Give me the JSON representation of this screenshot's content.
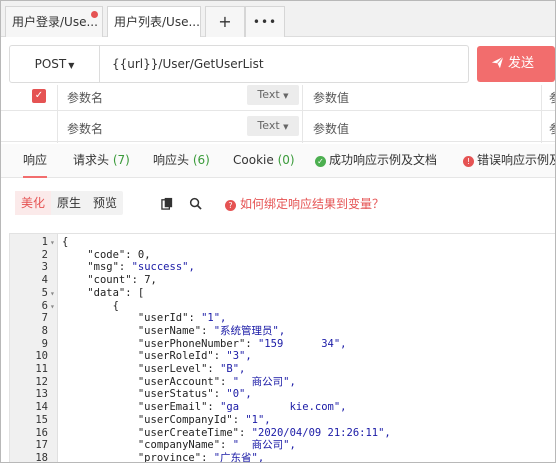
{
  "tabs": [
    {
      "label": "用户登录/Use..."
    },
    {
      "label": "用户列表/Use..."
    }
  ],
  "tab_actions": {
    "plus": "+",
    "more": "•••"
  },
  "request": {
    "method": "POST",
    "url": "{{url}}/User/GetUserList",
    "send_label": "发送"
  },
  "params": {
    "rows": [
      {
        "name": "参数名",
        "type": "Text",
        "value": "参数值",
        "cut": "参"
      },
      {
        "name": "参数名",
        "type": "Text",
        "value": "参数值",
        "cut": "参"
      }
    ]
  },
  "response_tabs": {
    "response": "响应",
    "req_headers": "请求头",
    "req_headers_count": "(7)",
    "res_headers": "响应头",
    "res_headers_count": "(6)",
    "cookie": "Cookie",
    "cookie_count": "(0)",
    "success_example": "成功响应示例及文档",
    "error_example": "错误响应示例及"
  },
  "toolbar": {
    "pretty": "美化",
    "raw": "原生",
    "preview": "预览",
    "help": "如何绑定响应结果到变量？"
  },
  "code_lines": [
    {
      "n": "1",
      "fold": "▾",
      "text": "{"
    },
    {
      "n": "2",
      "text": "    \"code\": 0,"
    },
    {
      "n": "3",
      "text": "    \"msg\": \"success\","
    },
    {
      "n": "4",
      "text": "    \"count\": 7,"
    },
    {
      "n": "5",
      "fold": "▾",
      "text": "    \"data\": ["
    },
    {
      "n": "6",
      "fold": "▾",
      "text": "        {"
    },
    {
      "n": "7",
      "text": "            \"userId\": \"1\","
    },
    {
      "n": "8",
      "text": "            \"userName\": \"系统管理员\","
    },
    {
      "n": "9",
      "text": "            \"userPhoneNumber\": \"159      34\","
    },
    {
      "n": "10",
      "text": "            \"userRoleId\": \"3\","
    },
    {
      "n": "11",
      "text": "            \"userLevel\": \"B\","
    },
    {
      "n": "12",
      "text": "            \"userAccount\": \"  商公司\","
    },
    {
      "n": "13",
      "text": "            \"userStatus\": \"0\","
    },
    {
      "n": "14",
      "text": "            \"userEmail\": \"ga        kie.com\","
    },
    {
      "n": "15",
      "text": "            \"userCompanyId\": \"1\","
    },
    {
      "n": "16",
      "text": "            \"userCreateTime\": \"2020/04/09 21:26:11\","
    },
    {
      "n": "17",
      "text": "            \"companyName\": \"  商公司\","
    },
    {
      "n": "18",
      "text": "            \"province\": \"广东省\","
    }
  ],
  "colors": {
    "accent": "#f26d6d",
    "success": "#4caf50",
    "error": "#e55353",
    "string": "#1a1aa6"
  }
}
